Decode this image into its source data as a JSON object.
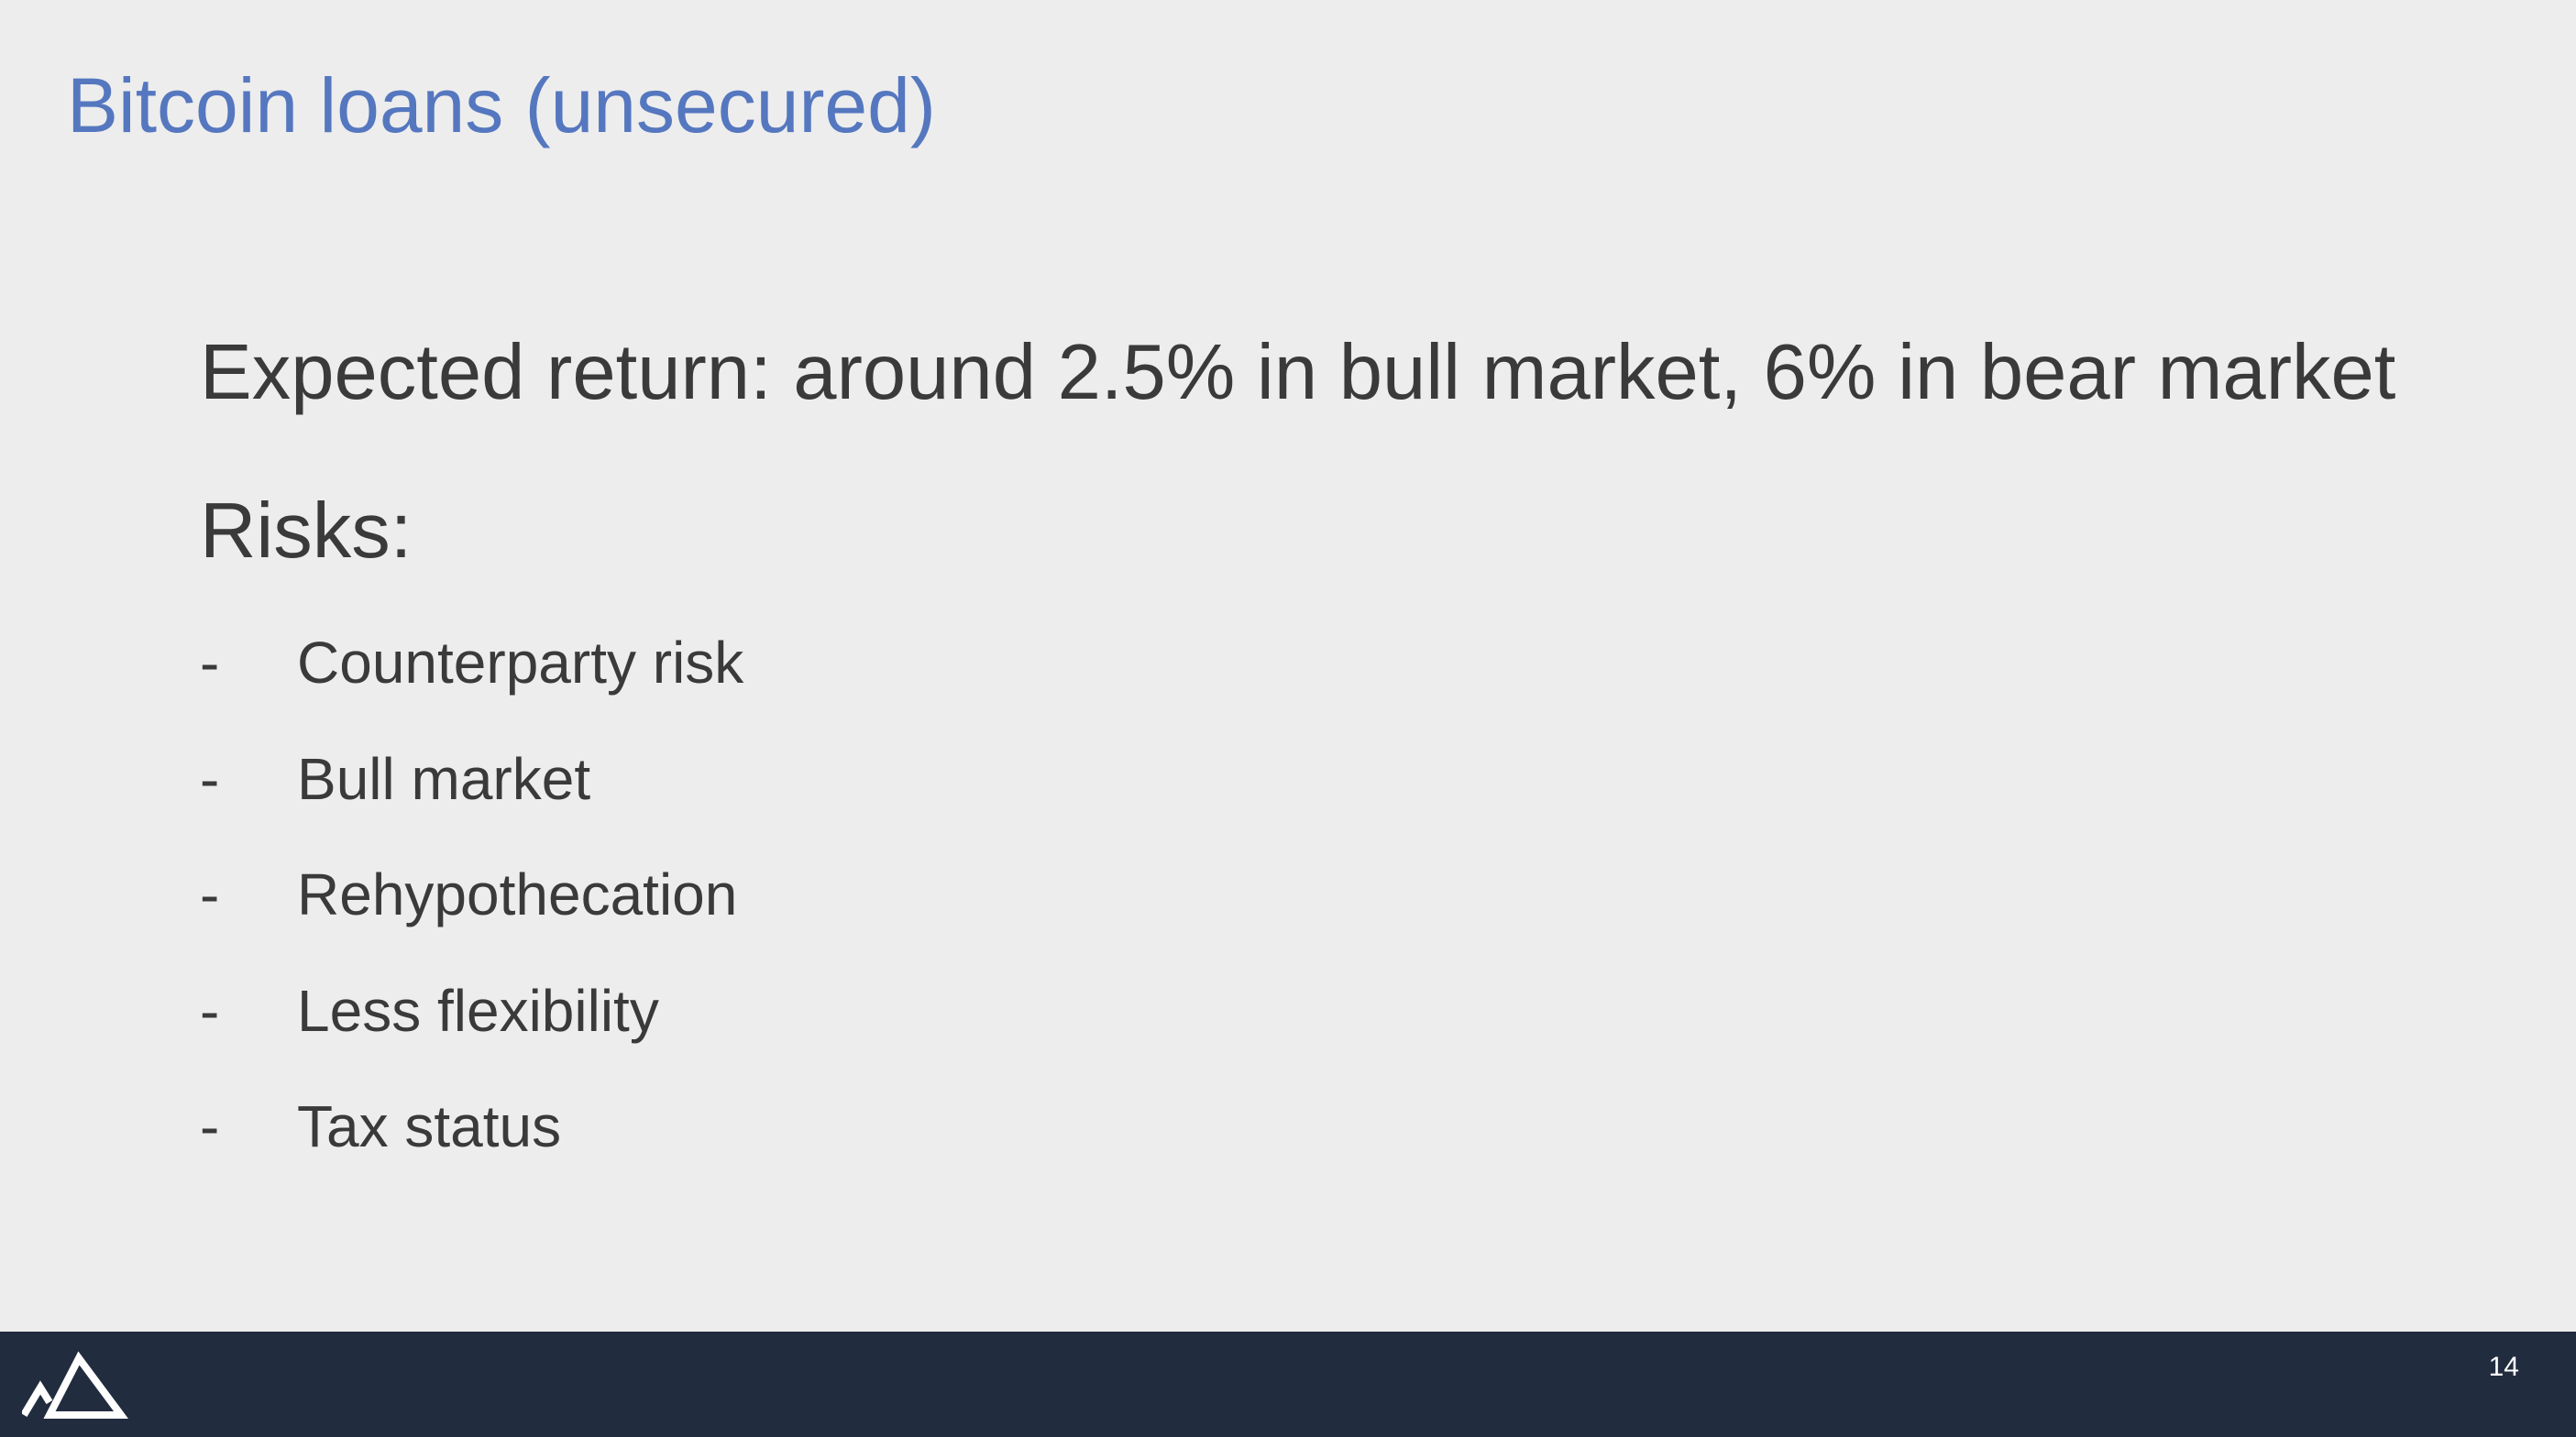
{
  "slide": {
    "title": "Bitcoin loans (unsecured)",
    "expected_return": "Expected return: around 2.5% in bull market, 6% in bear market",
    "risks_heading": "Risks:",
    "risks": [
      {
        "dash": "-",
        "text": "Counterparty risk"
      },
      {
        "dash": "-",
        "text": "Bull market"
      },
      {
        "dash": "-",
        "text": "Rehypothecation"
      },
      {
        "dash": "-",
        "text": "Less flexibility"
      },
      {
        "dash": "-",
        "text": "Tax status"
      }
    ],
    "page_number": "14"
  },
  "footer": {
    "logo_icon": "mountain-logo-icon"
  },
  "colors": {
    "background": "#ededed",
    "title": "#5577bf",
    "body_text": "#3a3a3a",
    "footer_bar": "#222c3f",
    "footer_text": "#ffffff"
  }
}
